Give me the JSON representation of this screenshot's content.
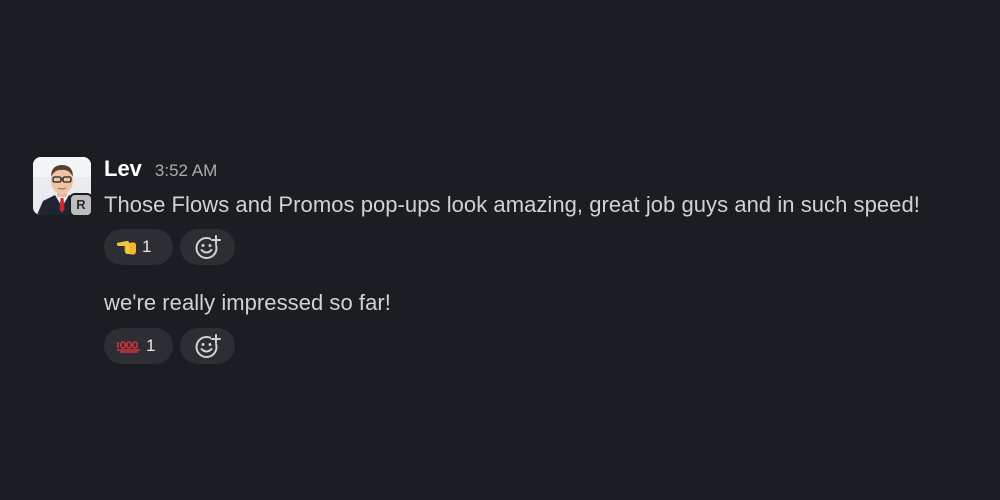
{
  "message": {
    "author": "Lev",
    "time": "3:52 AM",
    "avatar_badge": "R"
  },
  "messages": [
    {
      "text": "Those Flows and Promos pop-ups look amazing, great job guys and in such speed!",
      "reactions": [
        {
          "emoji": "backhand-index-pointing-left",
          "count": "1"
        }
      ]
    },
    {
      "text": "we're really impressed so far!",
      "reactions": [
        {
          "emoji": "1000-emoji",
          "count": "1"
        }
      ]
    }
  ],
  "colors": {
    "background": "#1a1d21",
    "text": "#d1d2d3",
    "author": "#ffffff",
    "timestamp": "#ababad",
    "pill": "#2c2e33"
  }
}
